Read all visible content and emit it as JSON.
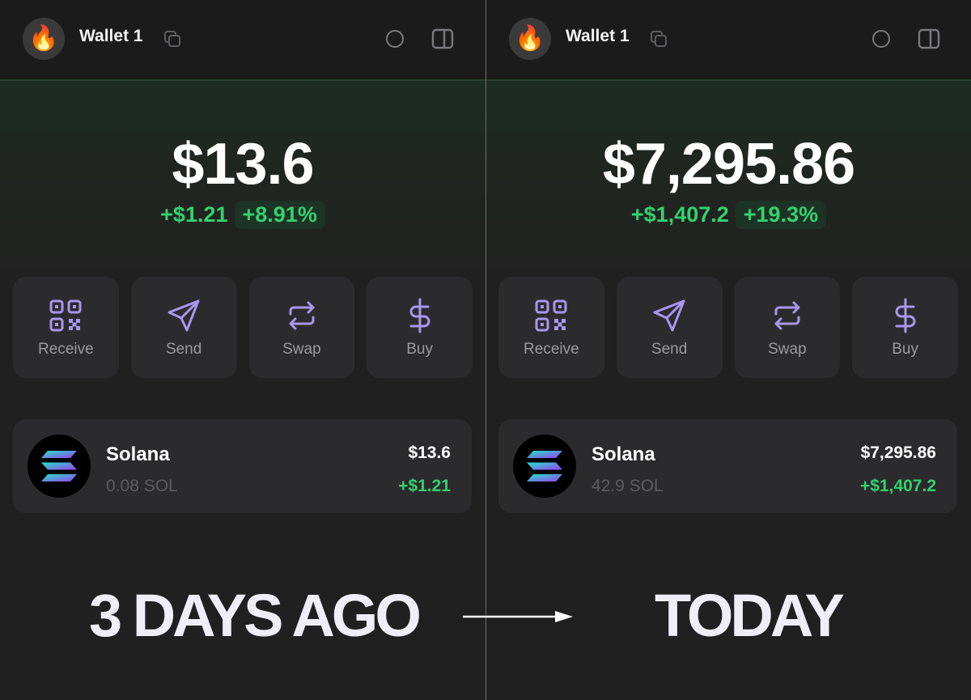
{
  "before": {
    "wallet_name": "Wallet 1",
    "avatar_emoji": "🔥",
    "balance": "$13.6",
    "change_abs": "+$1.21",
    "change_pct": "+8.91%",
    "actions": [
      "Receive",
      "Send",
      "Swap",
      "Buy"
    ],
    "token": {
      "name": "Solana",
      "amount": "0.08 SOL",
      "value": "$13.6",
      "change": "+$1.21"
    }
  },
  "after": {
    "wallet_name": "Wallet 1",
    "avatar_emoji": "🔥",
    "balance": "$7,295.86",
    "change_abs": "+$1,407.2",
    "change_pct": "+19.3%",
    "actions": [
      "Receive",
      "Send",
      "Swap",
      "Buy"
    ],
    "token": {
      "name": "Solana",
      "amount": "42.9 SOL",
      "value": "$7,295.86",
      "change": "+$1,407.2"
    }
  },
  "captions": {
    "before": "3 DAYS AGO",
    "after": "TODAY"
  },
  "colors": {
    "positive": "#33d16e",
    "accent_icon": "#a896f0",
    "card": "#2b2b2d",
    "background": "#202020"
  },
  "icons": {
    "receive": "qr-code-icon",
    "send": "send-arrow-icon",
    "swap": "swap-arrows-icon",
    "buy": "dollar-icon",
    "copy": "copy-icon",
    "status": "circle-icon",
    "sidebar": "sidebar-toggle-icon"
  }
}
